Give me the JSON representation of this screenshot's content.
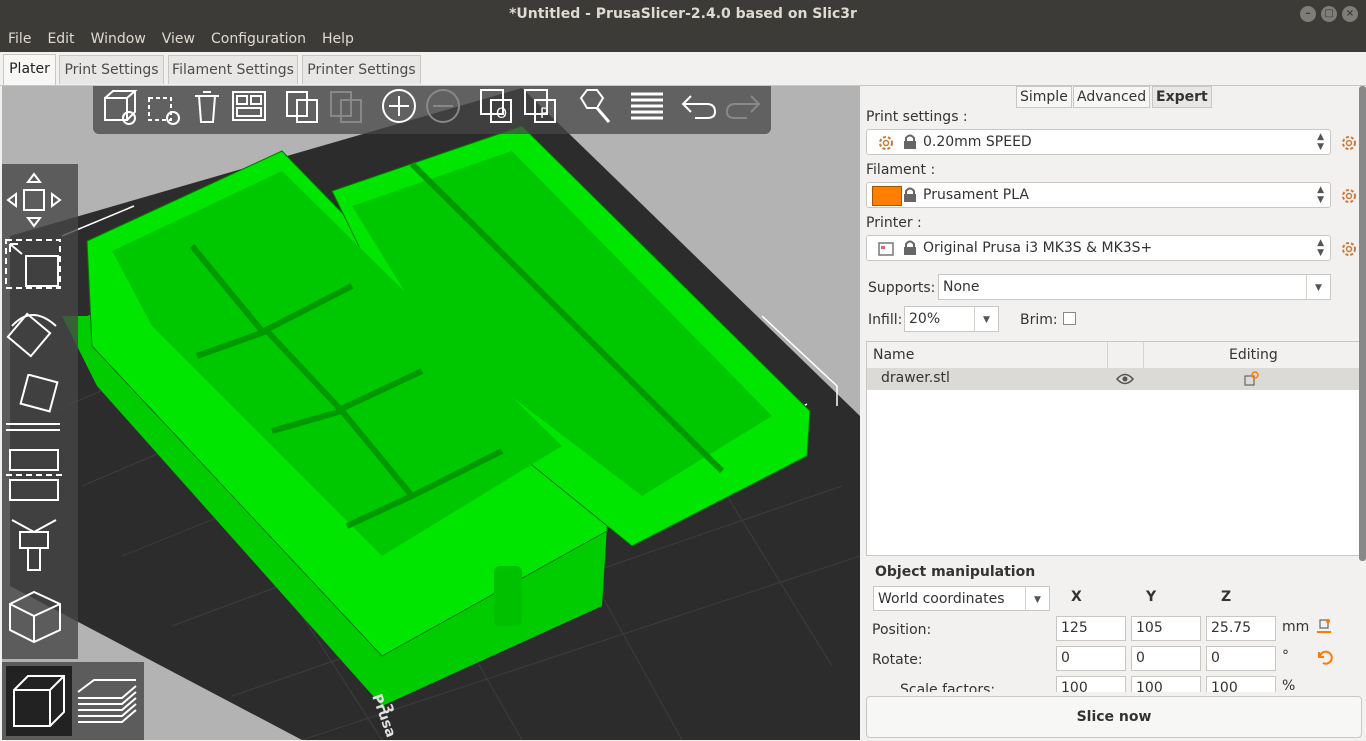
{
  "window": {
    "title": "*Untitled - PrusaSlicer-2.4.0 based on Slic3r"
  },
  "menu": [
    "File",
    "Edit",
    "Window",
    "View",
    "Configuration",
    "Help"
  ],
  "tabs": [
    "Plater",
    "Print Settings",
    "Filament Settings",
    "Printer Settings"
  ],
  "modes": [
    "Simple",
    "Advanced",
    "Expert"
  ],
  "print": {
    "label": "Print settings :",
    "value": "0.20mm SPEED"
  },
  "filament": {
    "label": "Filament :",
    "value": "Prusament PLA",
    "color": "#ff8000"
  },
  "printer": {
    "label": "Printer :",
    "value": "Original Prusa i3 MK3S & MK3S+"
  },
  "supports": {
    "label": "Supports:",
    "value": "None"
  },
  "infill": {
    "label": "Infill:",
    "value": "20%"
  },
  "brim": {
    "label": "Brim:",
    "checked": false
  },
  "objects": {
    "col_name": "Name",
    "col_editing": "Editing",
    "rows": [
      {
        "name": "drawer.stl"
      }
    ]
  },
  "manip": {
    "title": "Object manipulation",
    "coords": "World coordinates",
    "axes": [
      "X",
      "Y",
      "Z"
    ],
    "position": {
      "label": "Position:",
      "x": "125",
      "y": "105",
      "z": "25.75",
      "unit": "mm"
    },
    "rotate": {
      "label": "Rotate:",
      "x": "0",
      "y": "0",
      "z": "0",
      "unit": "°"
    },
    "scale": {
      "label": "Scale factors:",
      "x": "100",
      "y": "100",
      "z": "100",
      "unit": "%"
    }
  },
  "slice_button": "Slice now",
  "bed_text": [
    "3",
    "Prusa"
  ],
  "colors": {
    "model": "#00e600",
    "bed": "#2c2c2c",
    "background": "#b3b3b3"
  }
}
